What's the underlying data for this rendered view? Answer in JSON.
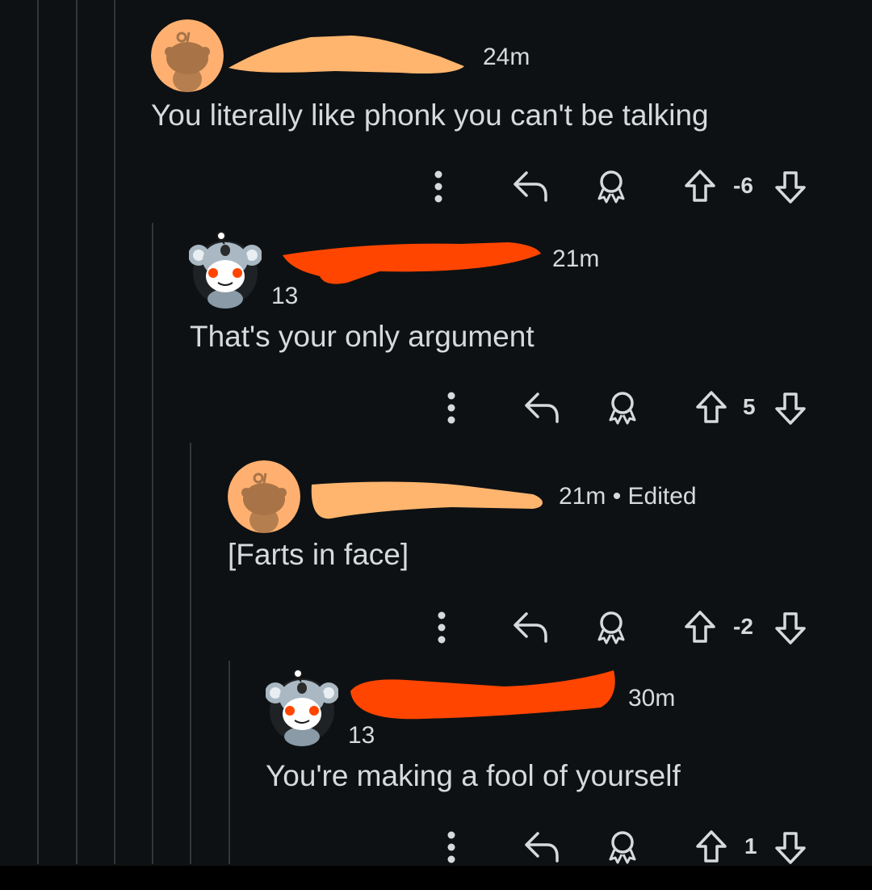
{
  "comments": [
    {
      "time": "24m",
      "edited": "",
      "karma": "",
      "body": "You literally like phonk you can't be talking",
      "score": "-6",
      "avatar_icon": "snoo-orange-avatar-icon"
    },
    {
      "time": "21m",
      "edited": "",
      "karma": "13",
      "body": "That's your only argument",
      "score": "5",
      "avatar_icon": "snoo-koala-avatar-icon"
    },
    {
      "time": "21m",
      "edited": "• Edited",
      "karma": "",
      "body": "[Farts in face]",
      "score": "-2",
      "avatar_icon": "snoo-orange-avatar-icon"
    },
    {
      "time": "30m",
      "edited": "",
      "karma": "13",
      "body": "You're making a fool of yourself",
      "score": "1",
      "avatar_icon": "snoo-koala-avatar-icon"
    }
  ],
  "icons": {
    "more": "more-options-icon",
    "reply": "reply-icon",
    "award": "award-icon",
    "upvote": "upvote-icon",
    "downvote": "downvote-icon"
  },
  "colors": {
    "background": "#0e1113",
    "thread_line": "#343536",
    "text": "#d7dadc",
    "redact_peach": "#ffb56e",
    "redact_red": "#ff4500",
    "avatar_orange": "#ffb070"
  }
}
